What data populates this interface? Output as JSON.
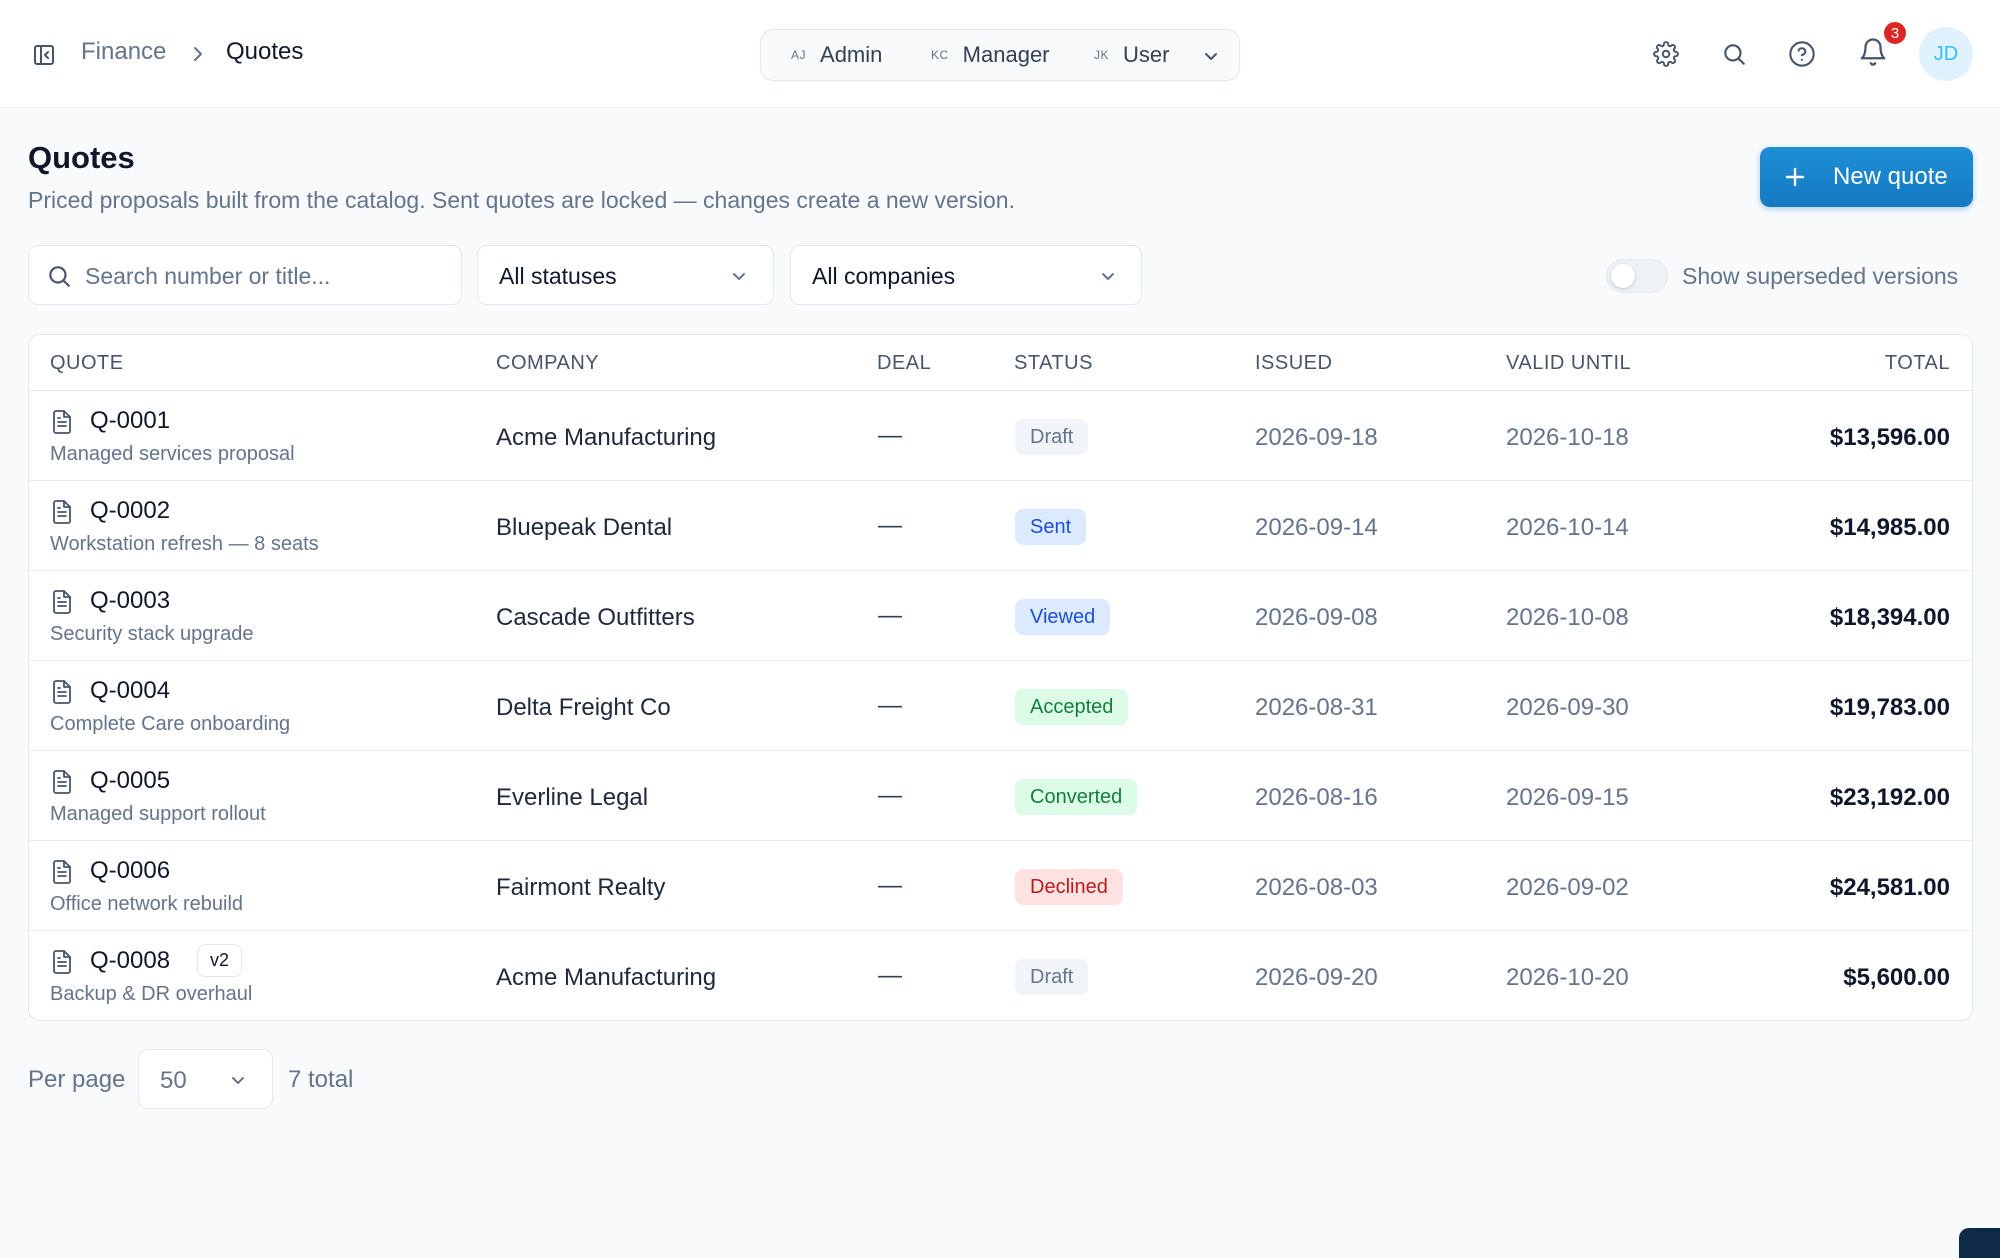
{
  "breadcrumb": {
    "parent": "Finance",
    "current": "Quotes"
  },
  "roles": [
    {
      "initials": "AJ",
      "label": "Admin"
    },
    {
      "initials": "KC",
      "label": "Manager"
    },
    {
      "initials": "JK",
      "label": "User"
    }
  ],
  "notifications": {
    "count": "3"
  },
  "user": {
    "initials": "JD"
  },
  "page": {
    "title": "Quotes",
    "subtitle": "Priced proposals built from the catalog. Sent quotes are locked — changes create a new version.",
    "new_button": "New quote"
  },
  "filters": {
    "search_placeholder": "Search number or title...",
    "status": "All statuses",
    "company": "All companies",
    "superseded_label": "Show superseded versions",
    "superseded_on": false
  },
  "table": {
    "headers": {
      "quote": "QUOTE",
      "company": "COMPANY",
      "deal": "DEAL",
      "status": "STATUS",
      "issued": "ISSUED",
      "valid": "VALID UNTIL",
      "total": "TOTAL"
    },
    "rows": [
      {
        "number": "Q-0001",
        "version": "",
        "title": "Managed services proposal",
        "company": "Acme Manufacturing",
        "deal": "—",
        "status": "Draft",
        "issued": "2026-09-18",
        "valid": "2026-10-18",
        "total": "$13,596.00"
      },
      {
        "number": "Q-0002",
        "version": "",
        "title": "Workstation refresh — 8 seats",
        "company": "Bluepeak Dental",
        "deal": "—",
        "status": "Sent",
        "issued": "2026-09-14",
        "valid": "2026-10-14",
        "total": "$14,985.00"
      },
      {
        "number": "Q-0003",
        "version": "",
        "title": "Security stack upgrade",
        "company": "Cascade Outfitters",
        "deal": "—",
        "status": "Viewed",
        "issued": "2026-09-08",
        "valid": "2026-10-08",
        "total": "$18,394.00"
      },
      {
        "number": "Q-0004",
        "version": "",
        "title": "Complete Care onboarding",
        "company": "Delta Freight Co",
        "deal": "—",
        "status": "Accepted",
        "issued": "2026-08-31",
        "valid": "2026-09-30",
        "total": "$19,783.00"
      },
      {
        "number": "Q-0005",
        "version": "",
        "title": "Managed support rollout",
        "company": "Everline Legal",
        "deal": "—",
        "status": "Converted",
        "issued": "2026-08-16",
        "valid": "2026-09-15",
        "total": "$23,192.00"
      },
      {
        "number": "Q-0006",
        "version": "",
        "title": "Office network rebuild",
        "company": "Fairmont Realty",
        "deal": "—",
        "status": "Declined",
        "issued": "2026-08-03",
        "valid": "2026-09-02",
        "total": "$24,581.00"
      },
      {
        "number": "Q-0008",
        "version": "v2",
        "title": "Backup & DR overhaul",
        "company": "Acme Manufacturing",
        "deal": "—",
        "status": "Draft",
        "issued": "2026-09-20",
        "valid": "2026-10-20",
        "total": "$5,600.00"
      }
    ]
  },
  "status_colors": {
    "Draft": {
      "bg": "#f1f5f9",
      "fg": "#64748b"
    },
    "Sent": {
      "bg": "#dbeafe",
      "fg": "#1d4ed8"
    },
    "Viewed": {
      "bg": "#dbeafe",
      "fg": "#1d4ed8"
    },
    "Accepted": {
      "bg": "#dcfce7",
      "fg": "#15803d"
    },
    "Converted": {
      "bg": "#dcfce7",
      "fg": "#15803d"
    },
    "Declined": {
      "bg": "#fee2e2",
      "fg": "#b91c1c"
    }
  },
  "pagination": {
    "per_page_label": "Per page",
    "per_page": "50",
    "total_label": "7 total"
  },
  "accent_color": "#1479c1"
}
